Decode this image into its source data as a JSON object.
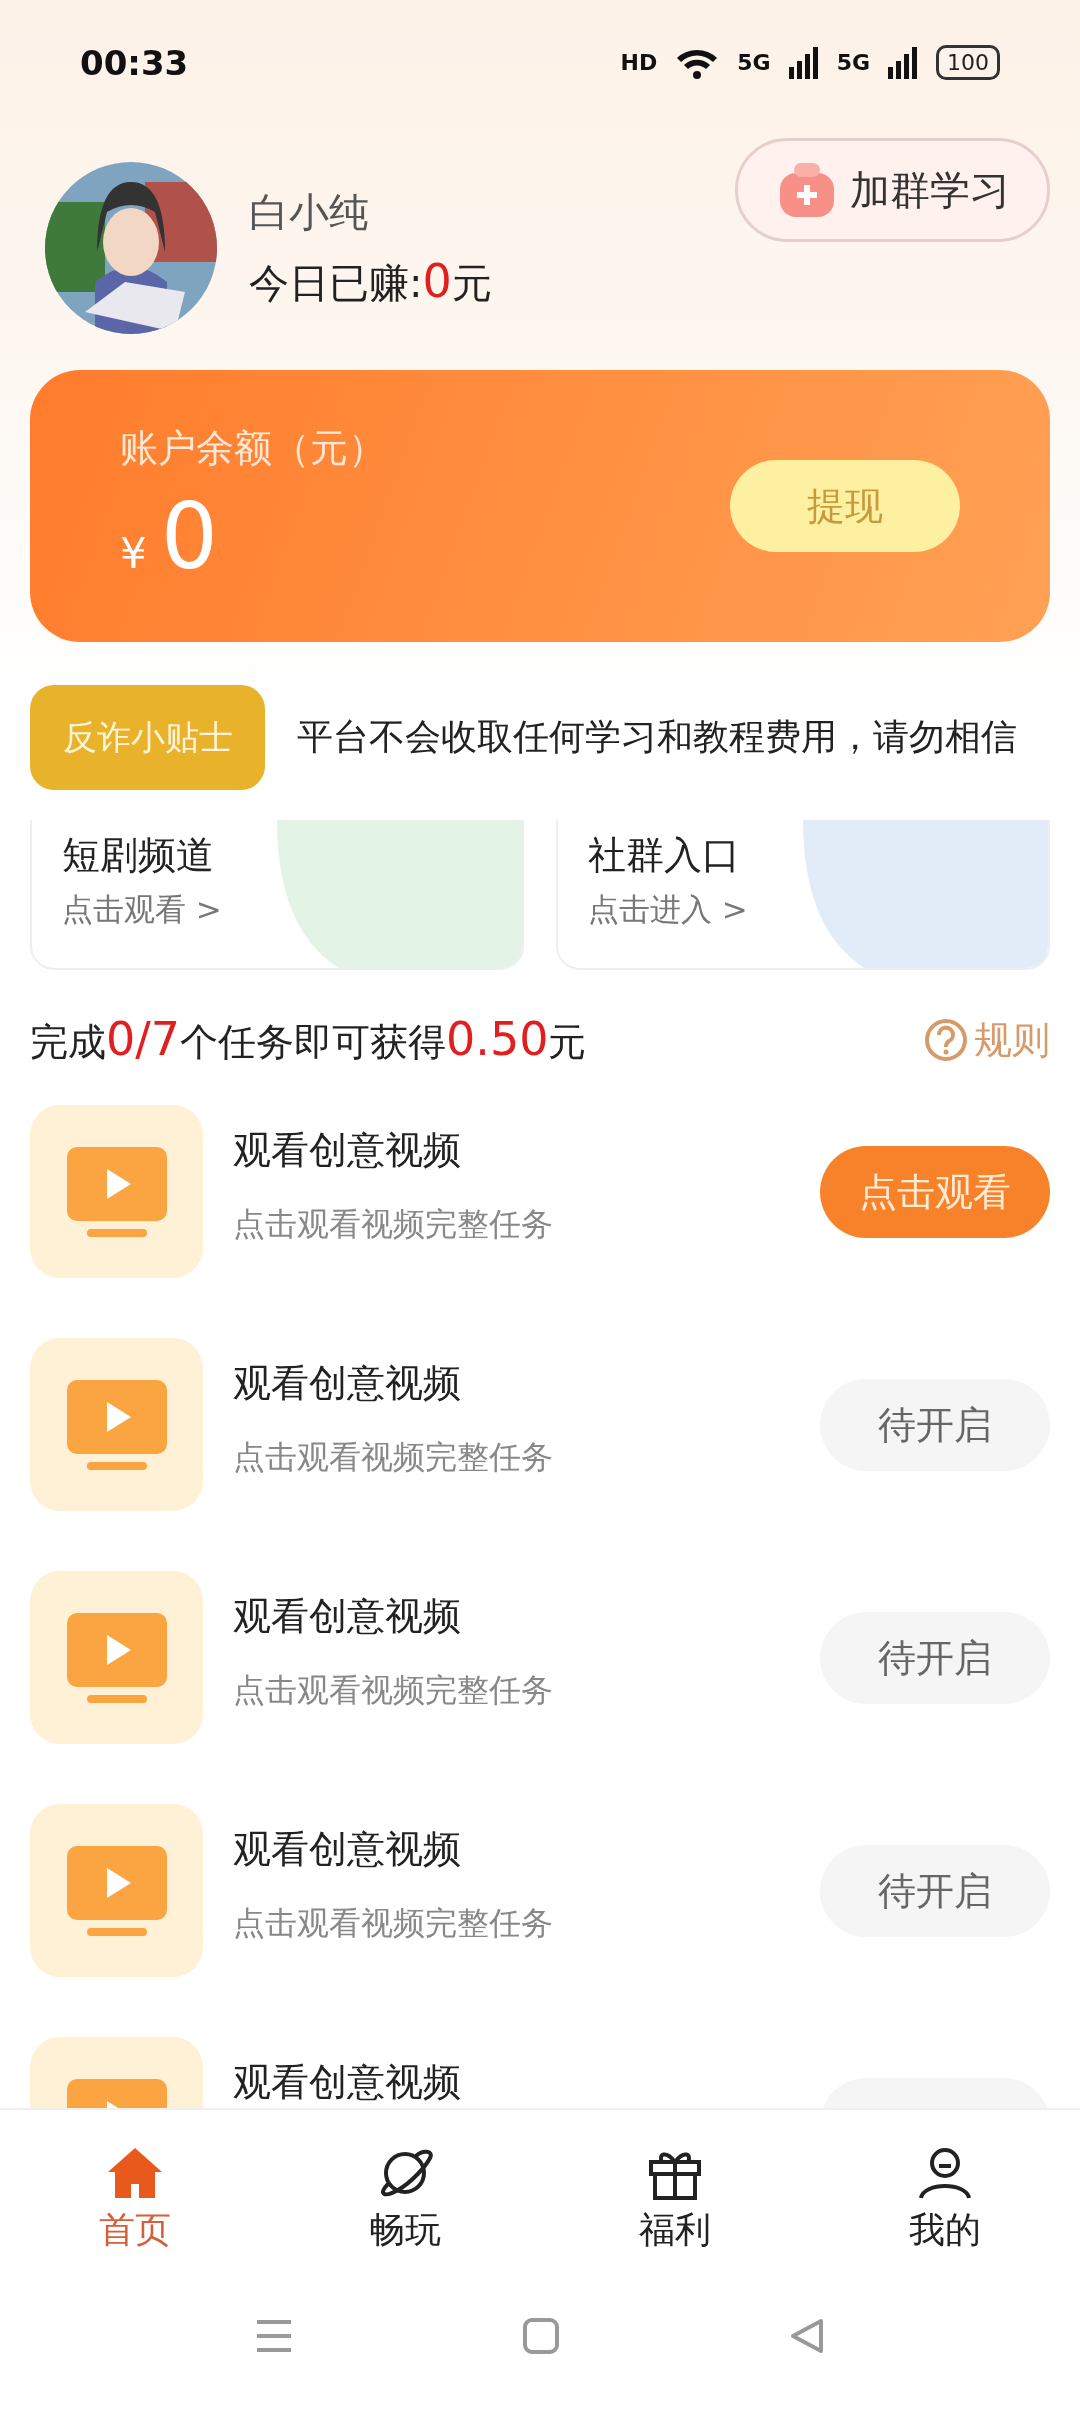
{
  "status_bar": {
    "time": "00:33",
    "indicators": [
      "HD",
      "5G",
      "5G"
    ],
    "battery": "100"
  },
  "profile": {
    "name": "白小纯",
    "earned_label": "今日已赚:",
    "earned_value": "0",
    "earned_unit": "元",
    "join_button": "加群学习"
  },
  "balance": {
    "label": "账户余额（元）",
    "currency": "¥",
    "amount": "0",
    "withdraw_button": "提现"
  },
  "tip": {
    "badge": "反诈小贴士",
    "text": "平台不会收取任何学习和教程费用，请勿相信"
  },
  "shortcuts": [
    {
      "title": "短剧频道",
      "link": "点击观看 >",
      "color": "#e3f4e6"
    },
    {
      "title": "社群入口",
      "link": "点击进入 >",
      "color": "#e2ecf8"
    }
  ],
  "task_header": {
    "text": "完成**0/7**个任务即可获得**0.50**元",
    "rules": "规则"
  },
  "tasks": [
    {
      "title": "观看创意视频",
      "subtitle": "点击观看视频完整任务",
      "kind": "active",
      "button": "点击观看"
    },
    {
      "title": "观看创意视频",
      "subtitle": "点击观看视频完整任务",
      "kind": "locked",
      "button": "待开启"
    },
    {
      "title": "观看创意视频",
      "subtitle": "点击观看视频完整任务",
      "kind": "locked",
      "button": "待开启"
    },
    {
      "title": "观看创意视频",
      "subtitle": "点击观看视频完整任务",
      "kind": "locked",
      "button": "待开启"
    },
    {
      "title": "观看创意视频",
      "kind": "locked"
    }
  ],
  "nav": [
    {
      "label": "首页",
      "kind": "home",
      "selected": true
    },
    {
      "label": "畅玩",
      "kind": "planet",
      "selected": false
    },
    {
      "label": "福利",
      "kind": "gift",
      "selected": false
    },
    {
      "label": "我的",
      "kind": "person",
      "selected": false
    }
  ]
}
